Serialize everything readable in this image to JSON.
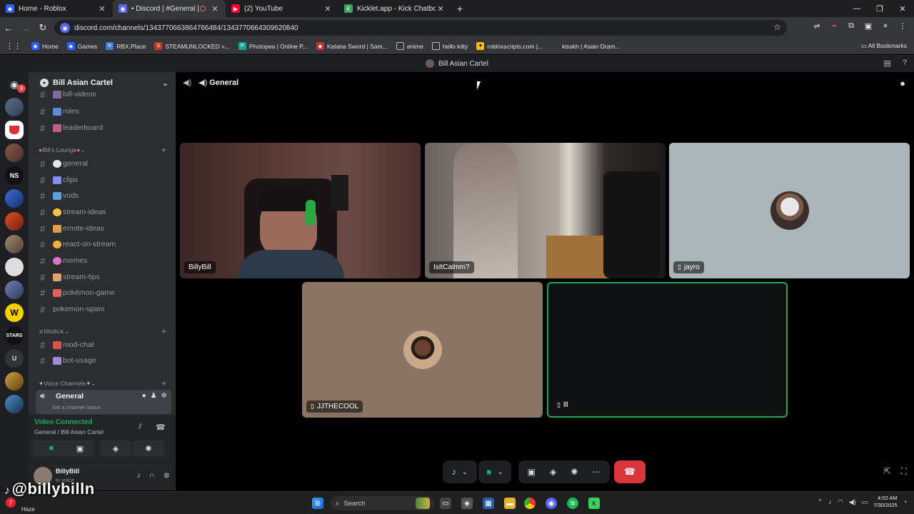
{
  "browser": {
    "tabs": [
      {
        "title": "Home - Roblox",
        "active": false
      },
      {
        "title": "• Discord | #General | Bill",
        "active": true
      },
      {
        "title": "(2) YouTube",
        "active": false
      },
      {
        "title": "Kicklet.app - Kick Chatbot and",
        "active": false
      }
    ],
    "url": "discord.com/channels/1343770663864766484/1343770664309620840",
    "bookmarks": [
      "Home",
      "Games",
      "RBX.Place",
      "STEAMUNLOCKED »...",
      "Photopea | Online P...",
      "Katana Sword | Sam...",
      "anime",
      "hello kitty",
      "robloxscripts.com |...",
      "kisskh | Asian Dram..."
    ],
    "all_bookmarks": "All Bookmarks"
  },
  "discord": {
    "window_title": "Bill Asian Cartel",
    "server_name": "Bill Asian Cartel",
    "mention_badge": "3",
    "channels_top": [
      {
        "name": "bill-videos",
        "emoji_color": "#7a6f9b"
      },
      {
        "name": "roles",
        "emoji_color": "#5e8bd8"
      },
      {
        "name": "leaderboard",
        "emoji_color": "#c05f8a"
      }
    ],
    "categories": {
      "lounge": "Bill's Lounge",
      "mods": "Mods",
      "voice": "Voice Channels"
    },
    "lounge_channels": [
      {
        "name": "general",
        "emoji_color": "#e3e5e8"
      },
      {
        "name": "clips",
        "emoji_color": "#7c8ef0"
      },
      {
        "name": "vods",
        "emoji_color": "#5aa0e0"
      },
      {
        "name": "stream-ideas",
        "emoji_color": "#f3c44a"
      },
      {
        "name": "emote-ideas",
        "emoji_color": "#e29b49"
      },
      {
        "name": "react-on-stream",
        "emoji_color": "#f0b23a"
      },
      {
        "name": "memes",
        "emoji_color": "#d974c9"
      },
      {
        "name": "stream-tips",
        "emoji_color": "#e0a070"
      },
      {
        "name": "pokémon-game",
        "emoji_color": "#e06060"
      },
      {
        "name": "pokemon-spam",
        "emoji_color": ""
      }
    ],
    "mods_channels": [
      {
        "name": "mod-chat",
        "emoji_color": "#d9534f"
      },
      {
        "name": "bot-usage",
        "emoji_color": "#a28bd4"
      }
    ],
    "voice_channel": {
      "name": "General",
      "status_placeholder": "Set a channel status"
    },
    "connection": {
      "status": "Video Connected",
      "location": "General / Bill Asian Cartel"
    },
    "user": {
      "name": "BillyBill",
      "status": "In voice"
    },
    "main_channel": "General",
    "participants": [
      {
        "name": "BillyBill",
        "mobile": false,
        "type": "video-person"
      },
      {
        "name": "IsItCalmm?",
        "mobile": false,
        "type": "video-room"
      },
      {
        "name": "jayro",
        "mobile": true,
        "type": "avatar",
        "bg": "#aab6b8"
      },
      {
        "name": "JJTHECOOL",
        "mobile": true,
        "type": "avatar",
        "bg": "#8a7565"
      },
      {
        "name": "lll",
        "mobile": true,
        "type": "speaking",
        "bg": "#111214"
      }
    ]
  },
  "overlay": {
    "watermark": "@billybilln"
  },
  "taskbar": {
    "search": "Search",
    "weather": "Haze",
    "weather_badge": "7",
    "time": "4:02 AM",
    "date": "7/30/2025"
  },
  "colors": {
    "discord_blurple": "#5865f2",
    "voice_green": "#23a55a",
    "hangup_red": "#da373c"
  }
}
